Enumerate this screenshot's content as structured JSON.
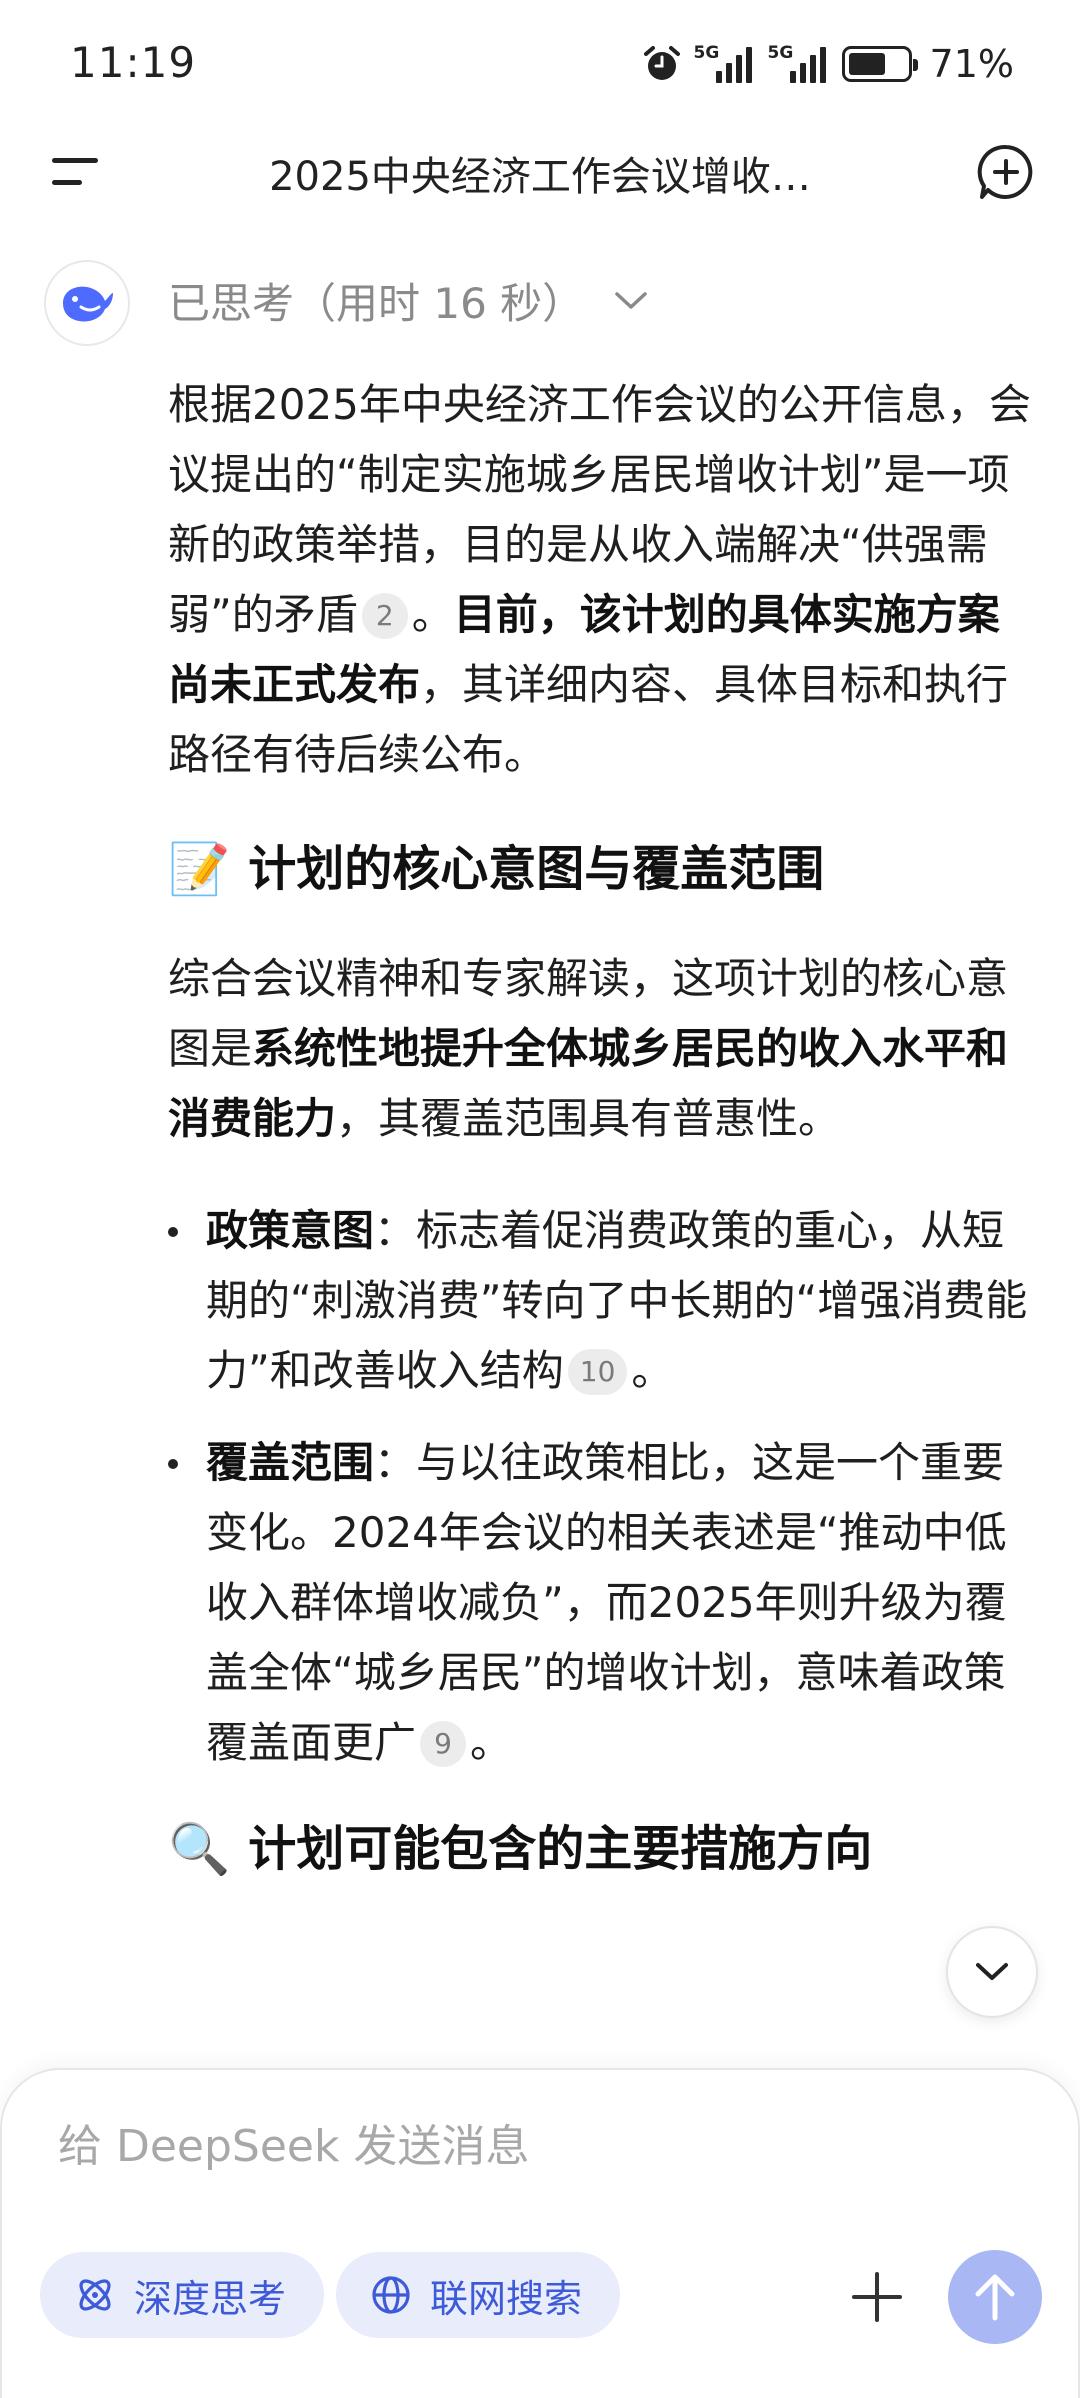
{
  "status_bar": {
    "time": "11:19",
    "network_1": "5G",
    "network_2": "5G",
    "battery": "71%"
  },
  "header": {
    "title": "2025中央经济工作会议增收…",
    "menu_icon": "menu-icon",
    "new_chat_icon": "new-chat-icon"
  },
  "message": {
    "thinking_label": "已思考（用时 16 秒）",
    "p1": {
      "text_a": "根据2025年中央经济工作会议的公开信息，会议提出的“制定实施城乡居民增收计划”是一项新的政策举措，目的是从收入端解决“供强需弱”的矛盾",
      "cite": "2",
      "text_b": "。",
      "bold": "目前，该计划的具体实施方案尚未正式发布",
      "text_c": "，其详细内容、具体目标和执行路径有待后续公布。"
    },
    "h1": {
      "emoji": "📝",
      "text": "计划的核心意图与覆盖范围"
    },
    "p2": {
      "text_a": "综合会议精神和专家解读，这项计划的核心意图是",
      "bold": "系统性地提升全体城乡居民的收入水平和消费能力",
      "text_b": "，其覆盖范围具有普惠性。"
    },
    "bullets": [
      {
        "title": "政策意图",
        "text": "：标志着促消费政策的重心，从短期的“刺激消费”转向了中长期的“增强消费能力”和改善收入结构",
        "cite": "10",
        "tail": "。"
      },
      {
        "title": "覆盖范围",
        "text": "：与以往政策相比，这是一个重要变化。2024年会议的相关表述是“推动中低收入群体增收减负”，而2025年则升级为覆盖全体“城乡居民”的增收计划，意味着政策覆盖面更广",
        "cite": "9",
        "tail": "。"
      }
    ],
    "h2": {
      "emoji": "🔍",
      "text": "计划可能包含的主要措施方向"
    }
  },
  "composer": {
    "placeholder": "给 DeepSeek 发送消息",
    "deep_think_label": "深度思考",
    "web_search_label": "联网搜索"
  },
  "colors": {
    "accent": "#3d5ad8",
    "chip_bg": "#e8ecfb",
    "send_bg": "#a9b7f4",
    "logo": "#4d6bfe"
  }
}
